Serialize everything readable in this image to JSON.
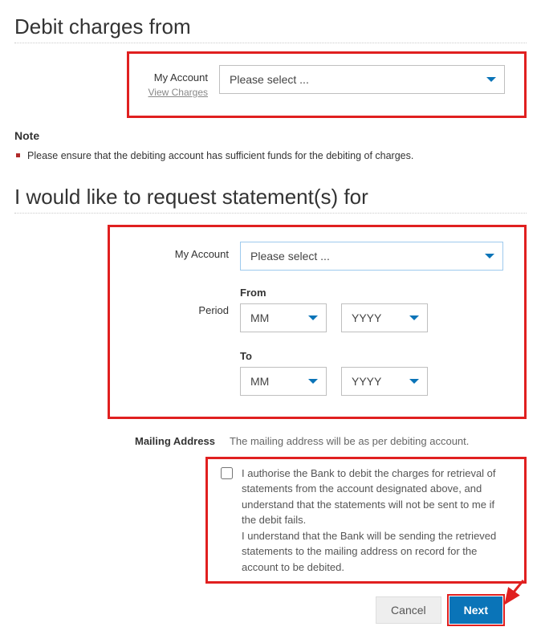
{
  "section1": {
    "heading": "Debit charges from",
    "account_label": "My Account",
    "view_charges": "View Charges",
    "select_placeholder": "Please select ..."
  },
  "note": {
    "heading": "Note",
    "item": "Please ensure that the debiting account has sufficient funds for the debiting of charges."
  },
  "section2": {
    "heading": "I would like to request statement(s) for",
    "account_label": "My Account",
    "select_placeholder": "Please select ...",
    "period_label": "Period",
    "from_label": "From",
    "to_label": "To",
    "mm": "MM",
    "yyyy": "YYYY"
  },
  "mailing": {
    "label": "Mailing Address",
    "text": "The mailing address will be as per debiting account."
  },
  "authorise": {
    "para1": "I authorise the Bank to debit the charges for retrieval of statements from the account designated above, and understand that the statements will not be sent to me if the debit fails.",
    "para2": "I understand that the Bank will be sending the retrieved statements to the mailing address on record for the account to be debited."
  },
  "buttons": {
    "cancel": "Cancel",
    "next": "Next"
  }
}
